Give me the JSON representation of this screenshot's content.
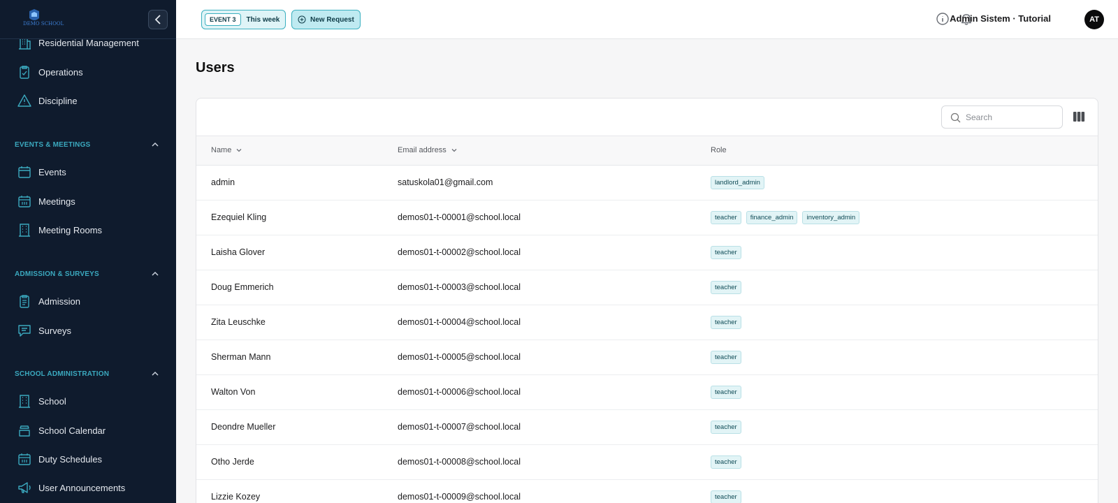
{
  "sidebar": {
    "logo_text": "DEMO SCHOOL",
    "items_top": [
      {
        "label": "Residential Management",
        "icon": "building-icon"
      },
      {
        "label": "Operations",
        "icon": "clipboard-check-icon"
      },
      {
        "label": "Discipline",
        "icon": "warning-triangle-icon"
      }
    ],
    "sections": [
      {
        "label": "EVENTS & MEETINGS",
        "items": [
          {
            "label": "Events",
            "icon": "calendar-icon"
          },
          {
            "label": "Meetings",
            "icon": "calendar-grid-icon"
          },
          {
            "label": "Meeting Rooms",
            "icon": "building-icon"
          }
        ]
      },
      {
        "label": "ADMISSION & SURVEYS",
        "items": [
          {
            "label": "Admission",
            "icon": "clipboard-icon"
          },
          {
            "label": "Surveys",
            "icon": "chat-icon"
          }
        ]
      },
      {
        "label": "SCHOOL ADMINISTRATION",
        "items": [
          {
            "label": "School",
            "icon": "building-icon"
          },
          {
            "label": "School Calendar",
            "icon": "archive-icon"
          },
          {
            "label": "Duty Schedules",
            "icon": "calendar-grid-icon"
          },
          {
            "label": "User Announcements",
            "icon": "megaphone-icon"
          }
        ]
      }
    ]
  },
  "topbar": {
    "event_tag": "EVENT 3",
    "event_period": "This week",
    "new_request_label": "New Request",
    "user_name": "Admin Sistem · Tutorial",
    "avatar_initials": "AT"
  },
  "page": {
    "title": "Users",
    "search_placeholder": "Search",
    "columns": {
      "name": "Name",
      "email": "Email address",
      "role": "Role"
    },
    "rows": [
      {
        "name": "admin",
        "email": "satuskola01@gmail.com",
        "roles": [
          "landlord_admin"
        ]
      },
      {
        "name": "Ezequiel Kling",
        "email": "demos01-t-00001@school.local",
        "roles": [
          "teacher",
          "finance_admin",
          "inventory_admin"
        ]
      },
      {
        "name": "Laisha Glover",
        "email": "demos01-t-00002@school.local",
        "roles": [
          "teacher"
        ]
      },
      {
        "name": "Doug Emmerich",
        "email": "demos01-t-00003@school.local",
        "roles": [
          "teacher"
        ]
      },
      {
        "name": "Zita Leuschke",
        "email": "demos01-t-00004@school.local",
        "roles": [
          "teacher"
        ]
      },
      {
        "name": "Sherman Mann",
        "email": "demos01-t-00005@school.local",
        "roles": [
          "teacher"
        ]
      },
      {
        "name": "Walton Von",
        "email": "demos01-t-00006@school.local",
        "roles": [
          "teacher"
        ]
      },
      {
        "name": "Deondre Mueller",
        "email": "demos01-t-00007@school.local",
        "roles": [
          "teacher"
        ]
      },
      {
        "name": "Otho Jerde",
        "email": "demos01-t-00008@school.local",
        "roles": [
          "teacher"
        ]
      },
      {
        "name": "Lizzie Kozey",
        "email": "demos01-t-00009@school.local",
        "roles": [
          "teacher"
        ]
      }
    ]
  },
  "colors": {
    "sidebar_bg": "#0f1b2d",
    "accent": "#3ba9bf",
    "badge_bg": "#e2f4f6"
  }
}
